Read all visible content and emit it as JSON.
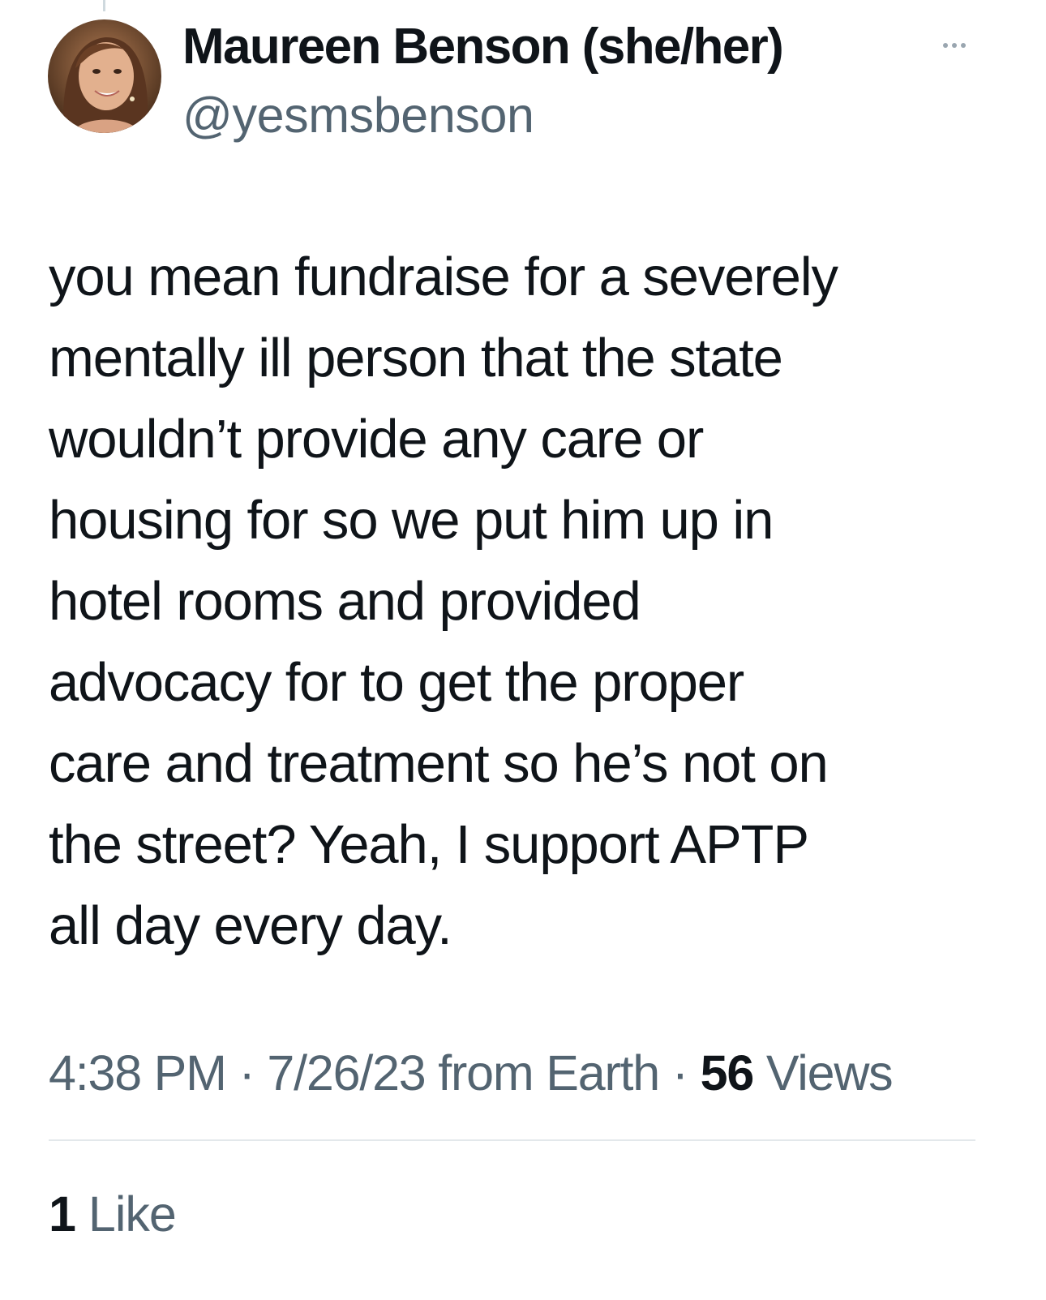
{
  "author": {
    "display_name": "Maureen Benson (she/her)",
    "handle": "@yesmsbenson"
  },
  "more_icon": "more-horizontal-icon",
  "tweet": {
    "lines": [
      "you mean fundraise for a severely",
      "mentally ill person that the state",
      "wouldn’t provide any care or",
      "housing for so we put him up in",
      "hotel rooms and provided",
      "advocacy for to get the proper",
      "care and treatment so he’s not on",
      "the street? Yeah, I support APTP",
      "all day every day."
    ]
  },
  "meta": {
    "time": "4:38 PM",
    "separator": "·",
    "date": "7/26/23",
    "source": "from Earth",
    "views_count": "56",
    "views_label": "Views"
  },
  "stats": {
    "likes_count": "1",
    "likes_label": "Like"
  },
  "colors": {
    "text_primary": "#0f1419",
    "text_secondary": "#536471",
    "divider": "#e3e8eb"
  }
}
